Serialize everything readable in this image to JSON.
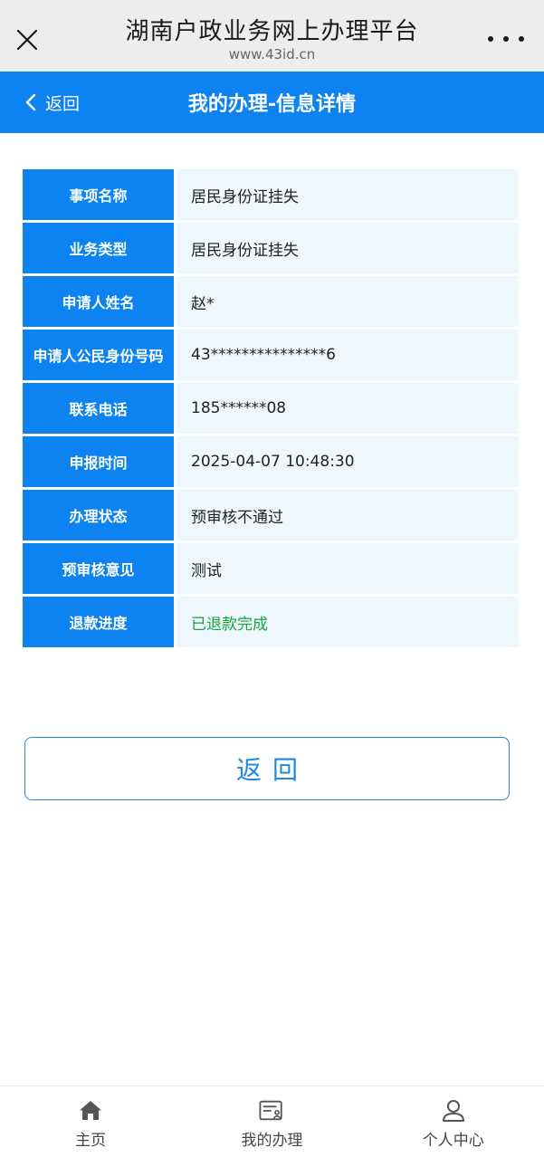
{
  "browser": {
    "title": "湖南户政业务网上办理平台",
    "url": "www.43id.cn",
    "close_icon": "close-icon",
    "more_icon": "more-horizontal-icon"
  },
  "header": {
    "back_label": "返回",
    "title": "我的办理-信息详情",
    "background_color": "#0d83f1"
  },
  "details": [
    {
      "label": "事项名称",
      "value": "居民身份证挂失"
    },
    {
      "label": "业务类型",
      "value": "居民身份证挂失"
    },
    {
      "label": "申请人姓名",
      "value": "赵*"
    },
    {
      "label": "申请人公民身份号码",
      "value": "43***************6"
    },
    {
      "label": "联系电话",
      "value": "185******08"
    },
    {
      "label": "申报时间",
      "value": "2025-04-07 10:48:30"
    },
    {
      "label": "办理状态",
      "value": "预审核不通过"
    },
    {
      "label": "预审核意见",
      "value": "测试"
    },
    {
      "label": "退款进度",
      "value": "已退款完成",
      "color": "#19a33a"
    }
  ],
  "return_button": {
    "label": "返回",
    "color": "#1e88e5"
  },
  "bottom_nav": [
    {
      "label": "主页",
      "icon": "home-icon"
    },
    {
      "label": "我的办理",
      "icon": "my-applications-icon"
    },
    {
      "label": "个人中心",
      "icon": "user-icon"
    }
  ]
}
